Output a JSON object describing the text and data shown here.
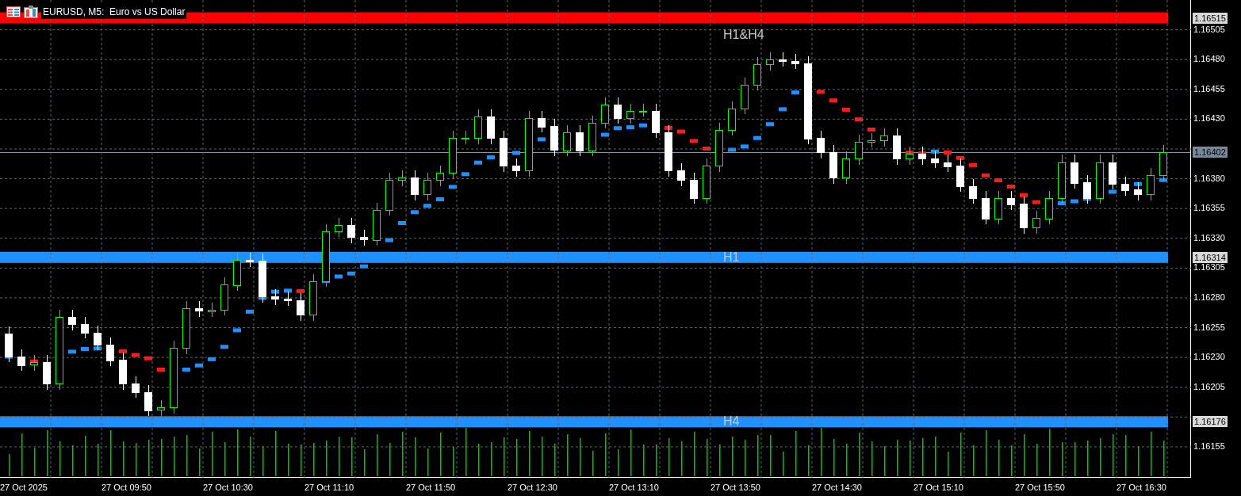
{
  "window": {
    "title": "EURUSD, M5:  Euro vs US Dollar"
  },
  "time_axis": {
    "labels": [
      "27 Oct 2025",
      "27 Oct 09:50",
      "27 Oct 10:30",
      "27 Oct 11:10",
      "27 Oct 11:50",
      "27 Oct 12:30",
      "27 Oct 13:10",
      "27 Oct 13:50",
      "27 Oct 14:30",
      "27 Oct 15:10",
      "27 Oct 15:50",
      "27 Oct 16:30"
    ]
  },
  "chart": {
    "chart_data": {
      "type": "candlestick",
      "grid": true,
      "ylim": [
        1.16129,
        1.1653
      ],
      "yticks": [
        {
          "value": 1.16505,
          "label": "1.16505"
        },
        {
          "value": 1.1648,
          "label": "1.16480"
        },
        {
          "value": 1.16455,
          "label": "1.16455"
        },
        {
          "value": 1.1643,
          "label": "1.16430"
        },
        {
          "value": 1.1638,
          "label": "1.16380"
        },
        {
          "value": 1.16355,
          "label": "1.16355"
        },
        {
          "value": 1.1633,
          "label": "1.16330"
        },
        {
          "value": 1.16305,
          "label": "1.16305"
        },
        {
          "value": 1.1628,
          "label": "1.16280"
        },
        {
          "value": 1.16255,
          "label": "1.16255"
        },
        {
          "value": 1.1623,
          "label": "1.16230"
        },
        {
          "value": 1.16205,
          "label": "1.16205"
        },
        {
          "value": 1.16155,
          "label": "1.16155"
        }
      ],
      "ohlc": [
        [
          1.1625,
          1.16256,
          1.16226,
          1.16231
        ],
        [
          1.16231,
          1.16237,
          1.16219,
          1.16224
        ],
        [
          1.16224,
          1.16232,
          1.16219,
          1.16226
        ],
        [
          1.16226,
          1.16232,
          1.16203,
          1.16208
        ],
        [
          1.16208,
          1.1627,
          1.16203,
          1.16264
        ],
        [
          1.16264,
          1.1627,
          1.16253,
          1.16258
        ],
        [
          1.16258,
          1.16264,
          1.16246,
          1.16251
        ],
        [
          1.16251,
          1.16257,
          1.16236,
          1.16241
        ],
        [
          1.16241,
          1.16247,
          1.16223,
          1.16228
        ],
        [
          1.16228,
          1.16234,
          1.16203,
          1.16208
        ],
        [
          1.16208,
          1.16214,
          1.16196,
          1.16201
        ],
        [
          1.16201,
          1.16207,
          1.16181,
          1.16186
        ],
        [
          1.16186,
          1.16194,
          1.16181,
          1.16188
        ],
        [
          1.16188,
          1.16244,
          1.16183,
          1.16238
        ],
        [
          1.16238,
          1.16277,
          1.16233,
          1.16271
        ],
        [
          1.16271,
          1.16277,
          1.16264,
          1.16269
        ],
        [
          1.16269,
          1.16276,
          1.16264,
          1.1627
        ],
        [
          1.1627,
          1.16297,
          1.16265,
          1.16291
        ],
        [
          1.16291,
          1.16318,
          1.16286,
          1.16312
        ],
        [
          1.16312,
          1.16318,
          1.16306,
          1.16311
        ],
        [
          1.16311,
          1.16317,
          1.16276,
          1.16281
        ],
        [
          1.16281,
          1.16287,
          1.16274,
          1.16279
        ],
        [
          1.16279,
          1.16285,
          1.16273,
          1.16278
        ],
        [
          1.16278,
          1.16284,
          1.16261,
          1.16266
        ],
        [
          1.16266,
          1.163,
          1.16261,
          1.16294
        ],
        [
          1.16294,
          1.16342,
          1.16289,
          1.16336
        ],
        [
          1.16336,
          1.16347,
          1.16331,
          1.16341
        ],
        [
          1.16341,
          1.16347,
          1.16326,
          1.16331
        ],
        [
          1.16331,
          1.16337,
          1.16324,
          1.16329
        ],
        [
          1.16329,
          1.1636,
          1.16324,
          1.16354
        ],
        [
          1.16354,
          1.16385,
          1.16349,
          1.16379
        ],
        [
          1.16379,
          1.16387,
          1.16374,
          1.16381
        ],
        [
          1.16381,
          1.16387,
          1.16362,
          1.16367
        ],
        [
          1.16367,
          1.16385,
          1.16362,
          1.16379
        ],
        [
          1.16379,
          1.16391,
          1.16374,
          1.16385
        ],
        [
          1.16385,
          1.1642,
          1.1638,
          1.16414
        ],
        [
          1.16414,
          1.1642,
          1.16409,
          1.16414
        ],
        [
          1.16414,
          1.16438,
          1.16409,
          1.16432
        ],
        [
          1.16432,
          1.16438,
          1.16409,
          1.16414
        ],
        [
          1.16414,
          1.1642,
          1.16386,
          1.16391
        ],
        [
          1.16391,
          1.16397,
          1.16382,
          1.16387
        ],
        [
          1.16387,
          1.16437,
          1.16382,
          1.16431
        ],
        [
          1.16431,
          1.16437,
          1.16419,
          1.16424
        ],
        [
          1.16424,
          1.1643,
          1.16399,
          1.16404
        ],
        [
          1.16404,
          1.16425,
          1.16399,
          1.16419
        ],
        [
          1.16419,
          1.16425,
          1.16399,
          1.16404
        ],
        [
          1.16404,
          1.16433,
          1.16399,
          1.16427
        ],
        [
          1.16427,
          1.16448,
          1.16422,
          1.16442
        ],
        [
          1.16442,
          1.16448,
          1.16426,
          1.16431
        ],
        [
          1.16431,
          1.16443,
          1.16426,
          1.16437
        ],
        [
          1.16437,
          1.16443,
          1.16432,
          1.16437
        ],
        [
          1.16437,
          1.16443,
          1.16414,
          1.16419
        ],
        [
          1.16419,
          1.16425,
          1.16382,
          1.16387
        ],
        [
          1.16387,
          1.16393,
          1.16374,
          1.16379
        ],
        [
          1.16379,
          1.16385,
          1.16359,
          1.16364
        ],
        [
          1.16364,
          1.16397,
          1.16359,
          1.16391
        ],
        [
          1.16391,
          1.16427,
          1.16386,
          1.16421
        ],
        [
          1.16421,
          1.16445,
          1.16416,
          1.16439
        ],
        [
          1.16439,
          1.16465,
          1.16434,
          1.16459
        ],
        [
          1.16459,
          1.16482,
          1.16454,
          1.16476
        ],
        [
          1.16476,
          1.16486,
          1.16471,
          1.1648
        ],
        [
          1.1648,
          1.16486,
          1.16474,
          1.16479
        ],
        [
          1.16479,
          1.16485,
          1.16472,
          1.16477
        ],
        [
          1.16477,
          1.16483,
          1.16409,
          1.16414
        ],
        [
          1.16414,
          1.1642,
          1.16397,
          1.16402
        ],
        [
          1.16402,
          1.16408,
          1.16376,
          1.16381
        ],
        [
          1.16381,
          1.16403,
          1.16376,
          1.16397
        ],
        [
          1.16397,
          1.16417,
          1.16392,
          1.16411
        ],
        [
          1.16411,
          1.16418,
          1.16406,
          1.16412
        ],
        [
          1.16412,
          1.16422,
          1.16407,
          1.16416
        ],
        [
          1.16416,
          1.16422,
          1.16392,
          1.16397
        ],
        [
          1.16397,
          1.16407,
          1.16392,
          1.16401
        ],
        [
          1.16401,
          1.16407,
          1.16392,
          1.16397
        ],
        [
          1.16397,
          1.16403,
          1.16389,
          1.16394
        ],
        [
          1.16394,
          1.164,
          1.16386,
          1.16391
        ],
        [
          1.16391,
          1.16397,
          1.16369,
          1.16374
        ],
        [
          1.16374,
          1.1638,
          1.16359,
          1.16364
        ],
        [
          1.16364,
          1.1637,
          1.16342,
          1.16347
        ],
        [
          1.16347,
          1.1637,
          1.16342,
          1.16364
        ],
        [
          1.16364,
          1.1637,
          1.16354,
          1.16359
        ],
        [
          1.16359,
          1.16365,
          1.16334,
          1.16339
        ],
        [
          1.16339,
          1.16353,
          1.16334,
          1.16347
        ],
        [
          1.16347,
          1.1637,
          1.16342,
          1.16364
        ],
        [
          1.16364,
          1.164,
          1.16359,
          1.16394
        ],
        [
          1.16394,
          1.164,
          1.16372,
          1.16377
        ],
        [
          1.16377,
          1.16383,
          1.16359,
          1.16364
        ],
        [
          1.16364,
          1.164,
          1.16359,
          1.16394
        ],
        [
          1.16394,
          1.164,
          1.16371,
          1.16376
        ],
        [
          1.16376,
          1.16382,
          1.16366,
          1.16371
        ],
        [
          1.16371,
          1.16377,
          1.16362,
          1.16367
        ],
        [
          1.16367,
          1.16389,
          1.16362,
          1.16383
        ],
        [
          1.16383,
          1.16408,
          1.16378,
          1.16402
        ]
      ]
    }
  },
  "levels": [
    {
      "label": "H1&H4",
      "price_tag": "1.16515",
      "kind": "resistance",
      "color": "#ff0000"
    },
    {
      "label": "H1",
      "price_tag": "1.16314",
      "kind": "support",
      "color": "#1e90ff"
    },
    {
      "label": "H4",
      "price_tag": "1.16176",
      "kind": "support",
      "color": "#1e90ff"
    }
  ],
  "current_price": "1.16402"
}
